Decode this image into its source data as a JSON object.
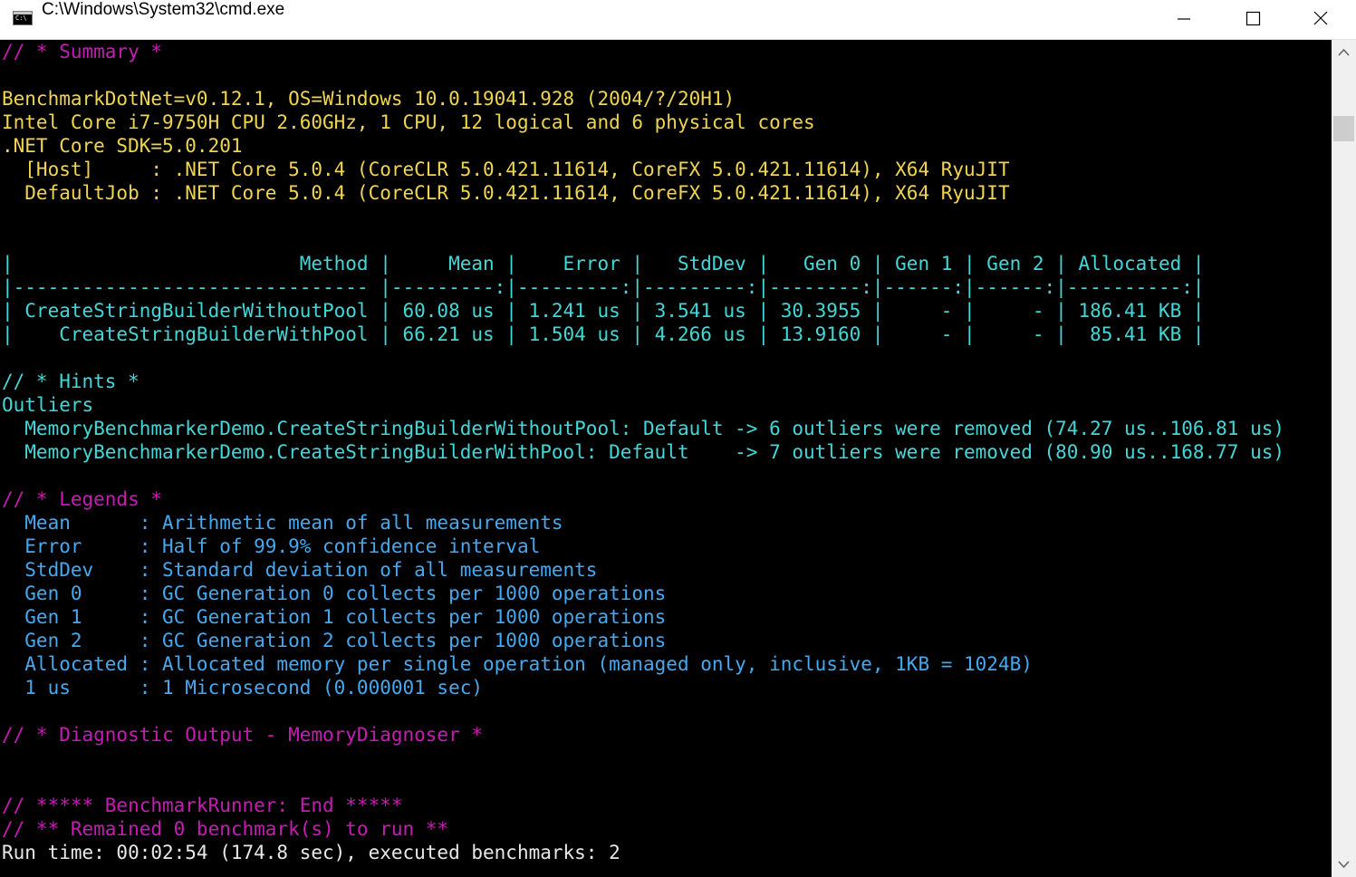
{
  "window": {
    "title": "C:\\Windows\\System32\\cmd.exe",
    "icon": "console-icon",
    "controls": [
      "minimize-icon",
      "maximize-icon",
      "close-icon"
    ]
  },
  "colors": {
    "magenta": "#c71bb3",
    "yellow": "#f0d550",
    "cyan": "#43d8d8",
    "blue": "#45a9f0",
    "white": "#e8e8e8"
  },
  "console": {
    "summary_header": "// * Summary *",
    "env": [
      "BenchmarkDotNet=v0.12.1, OS=Windows 10.0.19041.928 (2004/?/20H1)",
      "Intel Core i7-9750H CPU 2.60GHz, 1 CPU, 12 logical and 6 physical cores",
      ".NET Core SDK=5.0.201",
      "  [Host]     : .NET Core 5.0.4 (CoreCLR 5.0.421.11614, CoreFX 5.0.421.11614), X64 RyuJIT",
      "  DefaultJob : .NET Core 5.0.4 (CoreCLR 5.0.421.11614, CoreFX 5.0.421.11614), X64 RyuJIT"
    ],
    "table": {
      "header": "|                         Method |     Mean |    Error |   StdDev |   Gen 0 | Gen 1 | Gen 2 | Allocated |",
      "separator": "|------------------------------- |---------:|---------:|---------:|--------:|------:|------:|----------:|",
      "rows": [
        "| CreateStringBuilderWithoutPool | 60.08 us | 1.241 us | 3.541 us | 30.3955 |     - |     - | 186.41 KB |",
        "|    CreateStringBuilderWithPool | 66.21 us | 1.504 us | 4.266 us | 13.9160 |     - |     - |  85.41 KB |"
      ]
    },
    "hints_header": "// * Hints *",
    "outliers_label": "Outliers",
    "outliers": [
      "  MemoryBenchmarkerDemo.CreateStringBuilderWithoutPool: Default -> 6 outliers were removed (74.27 us..106.81 us)",
      "  MemoryBenchmarkerDemo.CreateStringBuilderWithPool: Default    -> 7 outliers were removed (80.90 us..168.77 us)"
    ],
    "legends_header": "// * Legends *",
    "legends": [
      "  Mean      : Arithmetic mean of all measurements",
      "  Error     : Half of 99.9% confidence interval",
      "  StdDev    : Standard deviation of all measurements",
      "  Gen 0     : GC Generation 0 collects per 1000 operations",
      "  Gen 1     : GC Generation 1 collects per 1000 operations",
      "  Gen 2     : GC Generation 2 collects per 1000 operations",
      "  Allocated : Allocated memory per single operation (managed only, inclusive, 1KB = 1024B)",
      "  1 us      : 1 Microsecond (0.000001 sec)"
    ],
    "diagnostic_header": "// * Diagnostic Output - MemoryDiagnoser *",
    "runner_end": "// ***** BenchmarkRunner: End *****",
    "remained": "// ** Remained 0 benchmark(s) to run **",
    "run_time": "Run time: 00:02:54 (174.8 sec), executed benchmarks: 2"
  }
}
